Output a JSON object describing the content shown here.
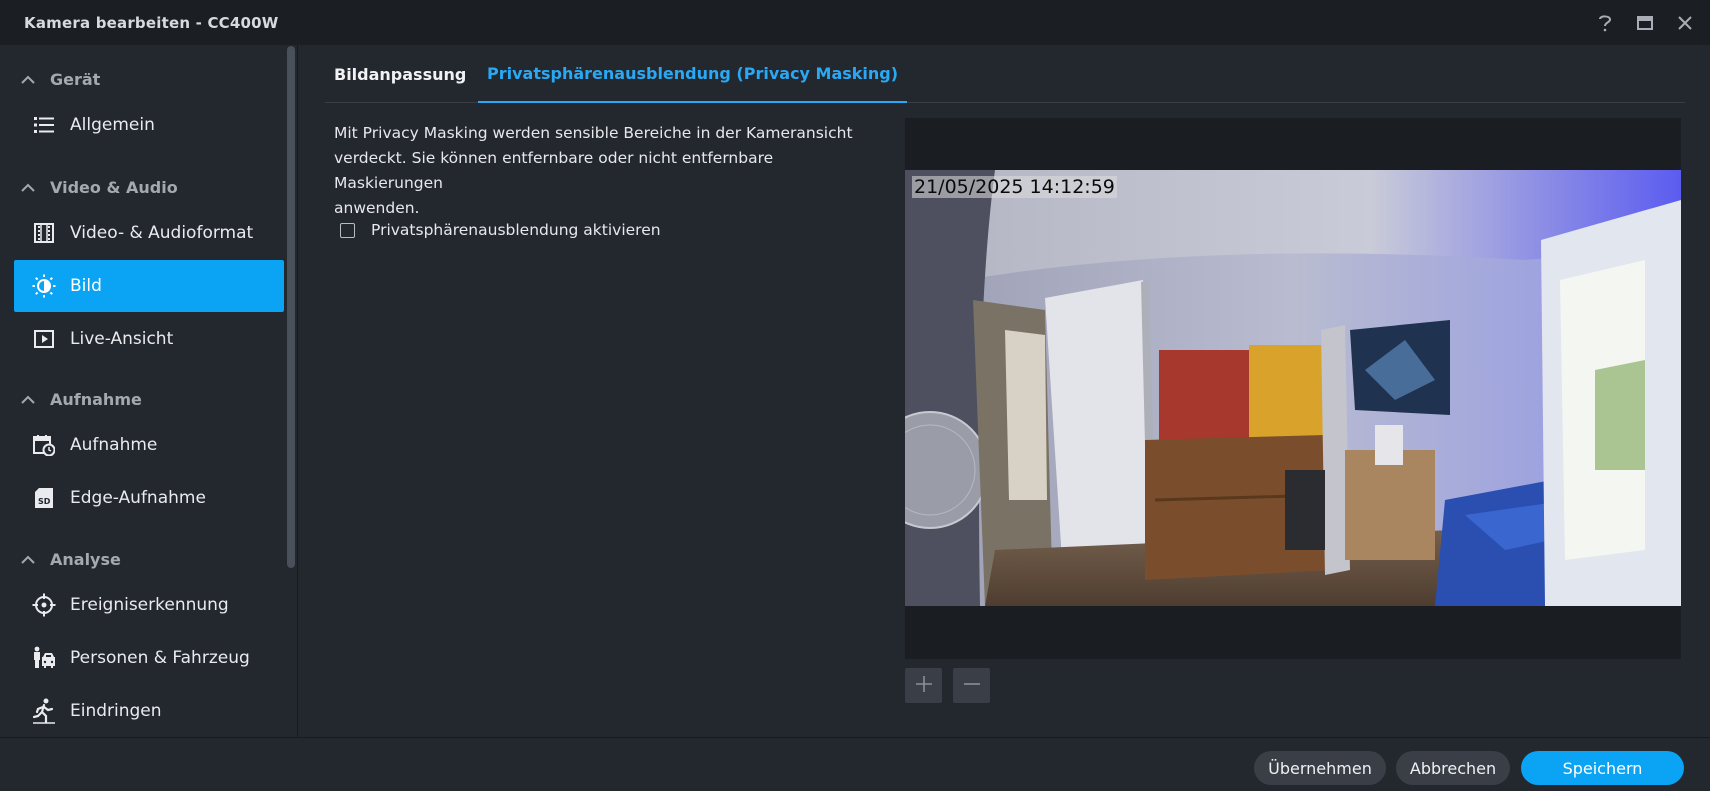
{
  "window": {
    "title": "Kamera bearbeiten - CC400W"
  },
  "sidebar": {
    "sections": [
      {
        "label": "Gerät",
        "items": [
          {
            "label": "Allgemein",
            "icon": "list-icon"
          }
        ]
      },
      {
        "label": "Video & Audio",
        "items": [
          {
            "label": "Video- & Audioformat",
            "icon": "film-icon"
          },
          {
            "label": "Bild",
            "icon": "brightness-icon",
            "active": true
          },
          {
            "label": "Live-Ansicht",
            "icon": "play-square-icon"
          }
        ]
      },
      {
        "label": "Aufnahme",
        "items": [
          {
            "label": "Aufnahme",
            "icon": "calendar-clock-icon"
          },
          {
            "label": "Edge-Aufnahme",
            "icon": "sd-card-icon"
          }
        ]
      },
      {
        "label": "Analyse",
        "items": [
          {
            "label": "Ereigniserkennung",
            "icon": "crosshair-icon"
          },
          {
            "label": "Personen & Fahrzeug",
            "icon": "person-car-icon"
          },
          {
            "label": "Eindringen",
            "icon": "person-running-icon"
          }
        ]
      }
    ]
  },
  "tabs": [
    {
      "label": "Bildanpassung",
      "active": false
    },
    {
      "label": "Privatsphärenausblendung (Privacy Masking)",
      "active": true
    }
  ],
  "privacy": {
    "description_lines": [
      "Mit Privacy Masking werden sensible Bereiche in der Kameransicht",
      "verdeckt. Sie können entfernbare oder nicht entfernbare Maskierungen",
      "anwenden."
    ],
    "checkbox_label": "Privatsphärenausblendung aktivieren",
    "checkbox_checked": false
  },
  "preview": {
    "timestamp": "21/05/2025 14:12:59"
  },
  "footer": {
    "apply_label": "Übernehmen",
    "cancel_label": "Abbrechen",
    "save_label": "Speichern"
  },
  "colors": {
    "accent": "#0ba3f4",
    "tab_active": "#29a9f5",
    "background": "#23272e",
    "titlebar": "#1b1e23"
  }
}
